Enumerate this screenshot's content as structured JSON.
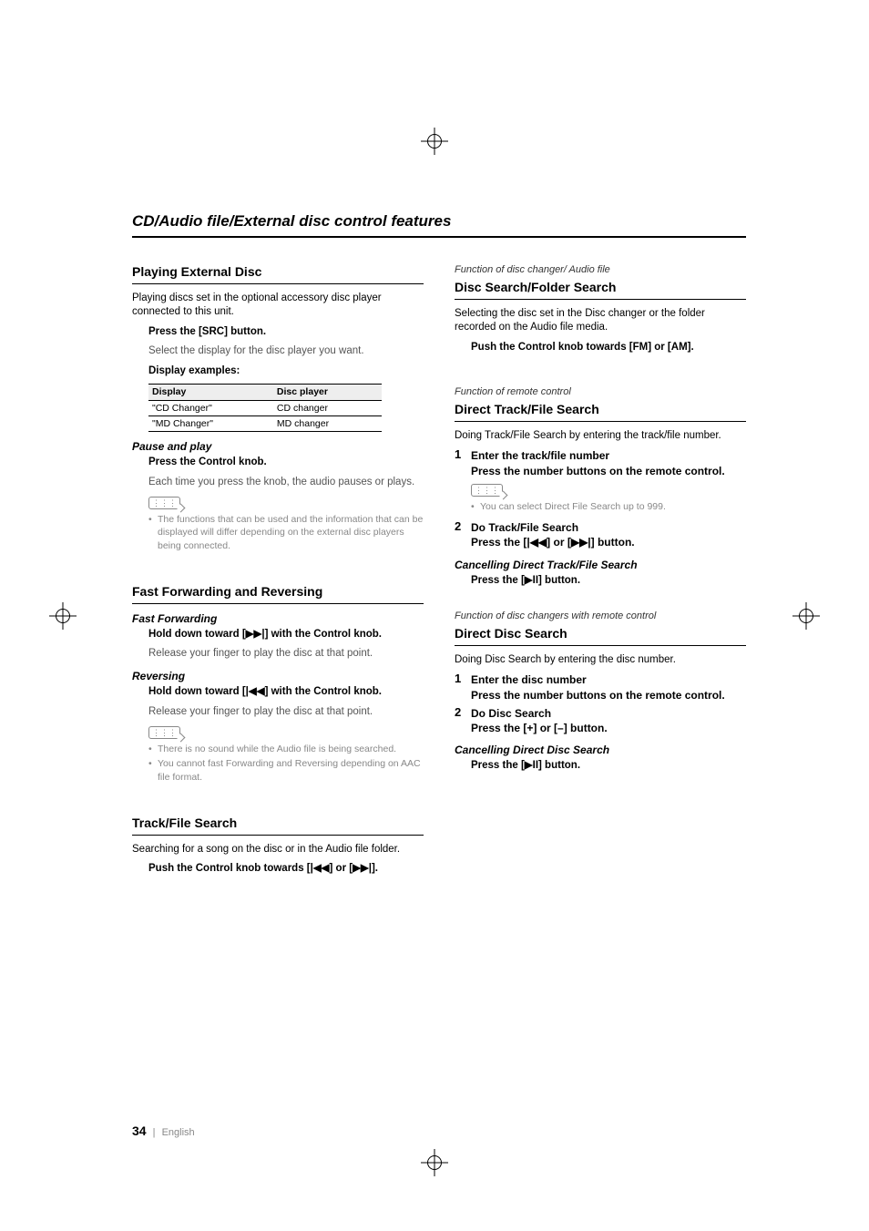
{
  "page_title": "CD/Audio file/External disc control features",
  "footer": {
    "page_number": "34",
    "separator": "|",
    "language": "English"
  },
  "left": {
    "sec1": {
      "title": "Playing External Disc",
      "intro": "Playing discs set in the optional accessory disc player connected to this unit.",
      "press_src": "Press the [SRC] button.",
      "select_display": "Select the display for the disc player you want.",
      "display_examples_label": "Display examples:",
      "table": {
        "h1": "Display",
        "h2": "Disc player",
        "r1c1": "\"CD Changer\"",
        "r1c2": "CD changer",
        "r2c1": "\"MD Changer\"",
        "r2c2": "MD changer"
      },
      "pause_play_head": "Pause and play",
      "press_control": "Press the Control knob.",
      "pause_play_body": "Each time you press the knob, the audio pauses or plays.",
      "note1": "The functions that can be used and the information that can be displayed will differ depending on the external disc players being connected."
    },
    "sec2": {
      "title": "Fast Forwarding and Reversing",
      "ff_head": "Fast Forwarding",
      "ff_hold": "Hold down toward [▶▶|] with the Control knob.",
      "ff_release": "Release your finger to play the disc at that point.",
      "rev_head": "Reversing",
      "rev_hold": "Hold down toward [|◀◀] with the Control knob.",
      "rev_release": "Release your finger to play the disc at that point.",
      "note1": "There is no sound while the Audio file is being searched.",
      "note2": "You cannot fast Forwarding and Reversing depending on AAC file format."
    },
    "sec3": {
      "title": "Track/File Search",
      "intro": "Searching for a song on the disc or in the Audio file folder.",
      "push": "Push the Control knob towards [|◀◀] or [▶▶|]."
    }
  },
  "right": {
    "sec4": {
      "context": "Function of disc changer/ Audio file",
      "title": "Disc Search/Folder Search",
      "intro": "Selecting the disc set in the Disc changer or the folder recorded on the Audio file media.",
      "push": "Push the Control knob towards [FM] or [AM]."
    },
    "sec5": {
      "context": "Function of remote control",
      "title": "Direct Track/File Search",
      "intro": "Doing Track/File Search by entering the track/file number.",
      "step1_head": "Enter the track/file number",
      "step1_body": "Press the number buttons on the remote control.",
      "note1": "You can select Direct File Search up to 999.",
      "step2_head": "Do Track/File Search",
      "step2_body": "Press the [|◀◀] or [▶▶|] button.",
      "cancel_head": "Cancelling Direct Track/File Search",
      "cancel_body": "Press the [▶II] button."
    },
    "sec6": {
      "context": "Function of disc changers with remote control",
      "title": "Direct Disc Search",
      "intro": "Doing Disc Search by entering the disc number.",
      "step1_head": "Enter the disc number",
      "step1_body": "Press the number buttons on the remote control.",
      "step2_head": "Do Disc Search",
      "step2_body": "Press the [+] or [–] button.",
      "cancel_head": "Cancelling Direct Disc Search",
      "cancel_body": "Press the [▶II] button."
    }
  }
}
